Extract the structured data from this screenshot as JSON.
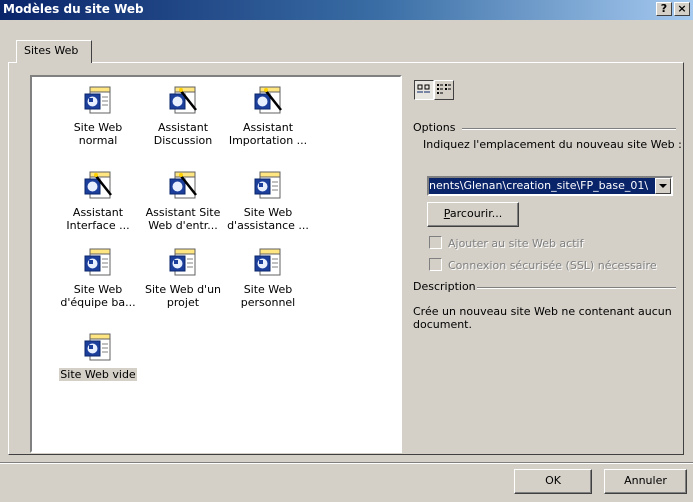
{
  "window": {
    "title": "Modèles du site Web",
    "help_label": "?",
    "close_label": "×"
  },
  "tabs": [
    {
      "label": "Sites Web"
    }
  ],
  "templates": [
    {
      "label_line1": "Site Web normal",
      "label_line2": "",
      "icon": "web-page-icon"
    },
    {
      "label_line1": "Assistant",
      "label_line2": "Discussion",
      "icon": "wizard-icon"
    },
    {
      "label_line1": "Assistant",
      "label_line2": "Importation ...",
      "icon": "wizard-icon"
    },
    {
      "label_line1": "Assistant",
      "label_line2": "Interface ...",
      "icon": "wizard-icon"
    },
    {
      "label_line1": "Assistant Site",
      "label_line2": "Web d'entr...",
      "icon": "wizard-icon"
    },
    {
      "label_line1": "Site Web",
      "label_line2": "d'assistance ...",
      "icon": "web-page-icon"
    },
    {
      "label_line1": "Site Web",
      "label_line2": "d'équipe ba...",
      "icon": "web-page-icon"
    },
    {
      "label_line1": "Site Web d'un",
      "label_line2": "projet",
      "icon": "web-page-icon"
    },
    {
      "label_line1": "Site Web",
      "label_line2": "personnel",
      "icon": "web-page-icon"
    },
    {
      "label_line1": "Site Web vide",
      "label_line2": "",
      "icon": "web-page-icon",
      "selected": true
    }
  ],
  "options": {
    "heading": "Options",
    "location_prompt": "Indiquez l'emplacement du nouveau site Web :",
    "location_value": "nents\\Glenan\\creation_site\\FP_base_01\\",
    "browse_label": "Parcourir...",
    "browse_access_key": "P",
    "browse_rest": "arcourir...",
    "checkbox_add_label": "Ajouter au site Web actif",
    "checkbox_ssl_label": "Connexion sécurisée (SSL) nécessaire"
  },
  "description": {
    "heading": "Description",
    "text": "Crée un nouveau site Web ne contenant aucun document."
  },
  "buttons": {
    "ok": "OK",
    "cancel": "Annuler"
  },
  "colors": {
    "title_bar": "#0a246a",
    "face": "#d4d0c8",
    "selection": "#0a246a"
  }
}
